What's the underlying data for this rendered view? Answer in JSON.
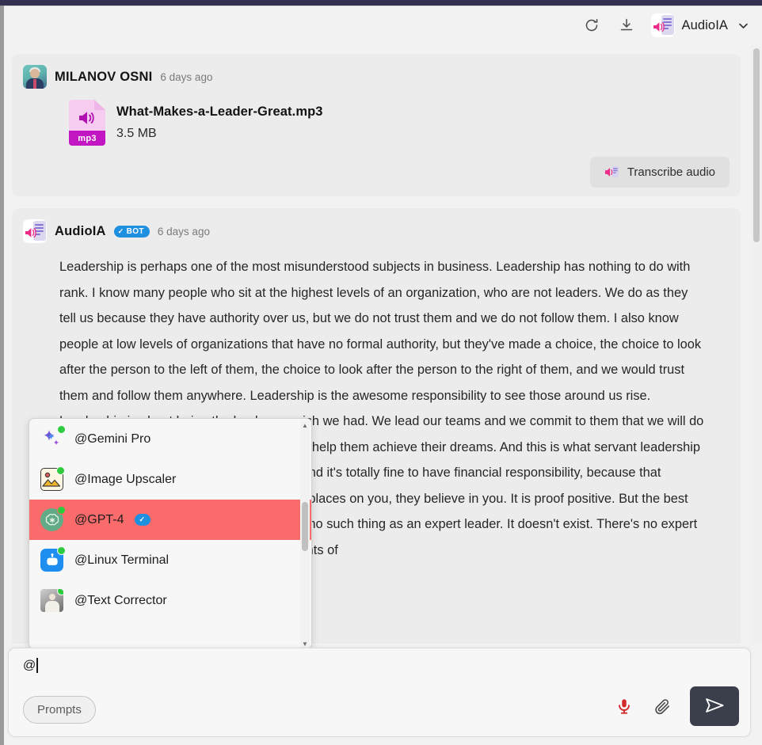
{
  "header": {
    "refresh_icon": "refresh-icon",
    "download_icon": "download-icon",
    "bot_name": "AudioIA",
    "chevron_icon": "chevron-down-icon"
  },
  "messages": {
    "user": {
      "sender": "MILANOV OSNI",
      "timestamp": "6 days ago",
      "file": {
        "name": "What-Makes-a-Leader-Great.mp3",
        "size": "3.5 MB",
        "type_label": "mp3"
      },
      "action_button": "Transcribe audio"
    },
    "bot": {
      "sender": "AudioIA",
      "badge": "BOT",
      "badge_check": "✓",
      "timestamp": "6 days ago",
      "transcript": "Leadership is perhaps one of the most misunderstood subjects in business. Leadership has nothing to do with rank. I know many people who sit at the highest levels of an organization, who are not leaders. We do as they tell us because they have authority over us, but we do not trust them and we do not follow them. I also know people at low levels of organizations that have no formal authority, but they've made a choice, the choice to look after the person to the left of them, the choice to look after the person to the right of them, and we would trust them and follow them anywhere. Leadership is the awesome responsibility to see those around us rise. Leadership is about being the leader we wish we had. We lead our teams and we commit to them that we will do everything in our power to see them rise, to help them achieve their dreams. And this is what servant leadership means. I don't care about my bottom line. And it's totally fine to have financial responsibility, because that becomes the proof of value that somebody places on you, they believe in you. It is proof positive. But the best leaders are students of leadership. There's no such thing as an expert leader. It doesn't exist. There's no expert parent. It doesn't exist, right? We are students of"
    }
  },
  "mention_dropdown": {
    "items": [
      {
        "label": "@Gemini Pro",
        "icon": "gemini-sparkle-icon",
        "online": true,
        "selected": false
      },
      {
        "label": "@Image Upscaler",
        "icon": "image-upscaler-icon",
        "online": true,
        "selected": false
      },
      {
        "label": "@GPT-4",
        "icon": "openai-logo-icon",
        "online": true,
        "selected": true,
        "badge": "✓"
      },
      {
        "label": "@Linux Terminal",
        "icon": "robot-icon",
        "online": true,
        "selected": false
      },
      {
        "label": "@Text Corrector",
        "icon": "photo-avatar-icon",
        "online": true,
        "selected": false
      }
    ],
    "scroll_up_icon": "▲",
    "scroll_down_icon": "▼"
  },
  "composer": {
    "value": "@",
    "prompts_button": "Prompts",
    "mic_icon": "microphone-icon",
    "attach_icon": "paperclip-icon",
    "send_icon": "send-icon"
  },
  "colors": {
    "accent_selected": "#fa6b6b",
    "badge_blue": "#1f8fe0",
    "send_dark": "#3a3f4b",
    "mic_red": "#d32a2a",
    "titlebar": "#343050",
    "mp3_magenta": "#c216c2"
  }
}
